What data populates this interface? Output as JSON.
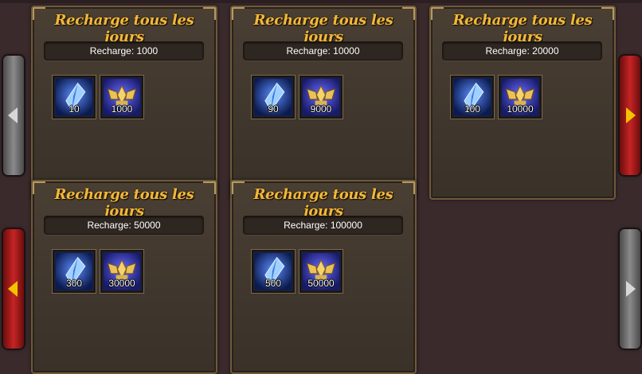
{
  "cards": [
    {
      "title": "Recharge tous les jours",
      "recharge": "Recharge: 1000",
      "items": [
        {
          "qty": "10",
          "kind": "crystal"
        },
        {
          "qty": "1000",
          "kind": "emblem"
        }
      ]
    },
    {
      "title": "Recharge tous les jours",
      "recharge": "Recharge: 10000",
      "items": [
        {
          "qty": "90",
          "kind": "crystal"
        },
        {
          "qty": "9000",
          "kind": "emblem"
        }
      ]
    },
    {
      "title": "Recharge tous les jours",
      "recharge": "Recharge: 20000",
      "items": [
        {
          "qty": "100",
          "kind": "crystal"
        },
        {
          "qty": "10000",
          "kind": "emblem"
        }
      ]
    },
    {
      "title": "Recharge tous les jours",
      "recharge": "Recharge: 50000",
      "items": [
        {
          "qty": "300",
          "kind": "crystal"
        },
        {
          "qty": "30000",
          "kind": "emblem"
        }
      ]
    },
    {
      "title": "Recharge tous les jours",
      "recharge": "Recharge: 100000",
      "items": [
        {
          "qty": "500",
          "kind": "crystal"
        },
        {
          "qty": "50000",
          "kind": "emblem"
        }
      ]
    }
  ],
  "nav": {
    "top_left": {
      "icon": "arrow-left-icon",
      "color": "#6f6f6f",
      "arrow": "#d8d8d8"
    },
    "top_right": {
      "icon": "arrow-right-icon",
      "color": "#9e1a1a",
      "arrow": "#f2c400"
    },
    "bottom_left": {
      "icon": "arrow-left-icon",
      "color": "#9e1a1a",
      "arrow": "#f2c400"
    },
    "bottom_right": {
      "icon": "arrow-right-icon",
      "color": "#6f6f6f",
      "arrow": "#d8d8d8"
    }
  }
}
